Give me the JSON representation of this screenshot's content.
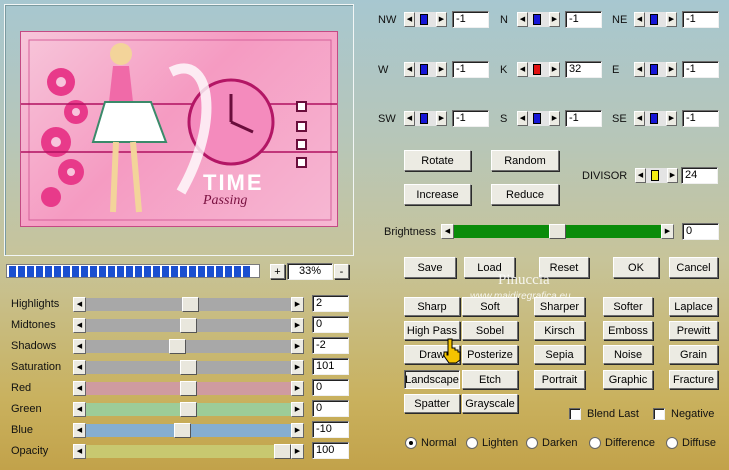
{
  "watermark": {
    "line1": "Pinuccia",
    "line2": "www.maidiregrafica.eu"
  },
  "preview": {
    "image_title": "TIME",
    "image_subtitle": "Passing",
    "zoom": "33%",
    "zoom_plus": "+",
    "zoom_minus": "-"
  },
  "directions": [
    {
      "label": "NW",
      "value": "-1",
      "color": "blue"
    },
    {
      "label": "N",
      "value": "-1",
      "color": "blue"
    },
    {
      "label": "NE",
      "value": "-1",
      "color": "blue"
    },
    {
      "label": "W",
      "value": "-1",
      "color": "blue"
    },
    {
      "label": "K",
      "value": "32",
      "color": "red"
    },
    {
      "label": "E",
      "value": "-1",
      "color": "blue"
    },
    {
      "label": "SW",
      "value": "-1",
      "color": "blue"
    },
    {
      "label": "S",
      "value": "-1",
      "color": "blue"
    },
    {
      "label": "SE",
      "value": "-1",
      "color": "blue"
    }
  ],
  "ops": {
    "rotate": "Rotate",
    "random": "Random",
    "increase": "Increase",
    "reduce": "Reduce"
  },
  "divisor": {
    "label": "DIVISOR",
    "value": "24"
  },
  "brightness": {
    "label": "Brightness",
    "value": "0",
    "level": 0.5,
    "color": "#0a8c0a"
  },
  "actions": {
    "save": "Save",
    "load": "Load",
    "reset": "Reset",
    "ok": "OK",
    "cancel": "Cancel"
  },
  "filters": [
    [
      "Sharp",
      "Soft",
      "Sharper",
      "Softer",
      "Laplace"
    ],
    [
      "High Pass",
      "Sobel",
      "Kirsch",
      "Emboss",
      "Prewitt"
    ],
    [
      "Draw",
      "Posterize",
      "Sepia",
      "Noise",
      "Grain"
    ],
    [
      "Landscape",
      "Etch",
      "Portrait",
      "Graphic",
      "Fracture"
    ],
    [
      "Spatter",
      "Grayscale"
    ]
  ],
  "options": {
    "blend_last": "Blend Last",
    "negative": "Negative"
  },
  "modes": {
    "selected": "Normal",
    "items": [
      "Normal",
      "Lighten",
      "Darken",
      "Difference",
      "Diffuse"
    ]
  },
  "adjustments": [
    {
      "label": "Highlights",
      "value": "2",
      "level": 0.51,
      "color": "#a8a8a8"
    },
    {
      "label": "Midtones",
      "value": "0",
      "level": 0.5,
      "color": "#a8a8a8"
    },
    {
      "label": "Shadows",
      "value": "-2",
      "level": 0.44,
      "color": "#a8a8a8"
    },
    {
      "label": "Saturation",
      "value": "101",
      "level": 0.5,
      "color": "#a8a8a8"
    },
    {
      "label": "Red",
      "value": "0",
      "level": 0.5,
      "color": "#cf9ba0"
    },
    {
      "label": "Green",
      "value": "0",
      "level": 0.5,
      "color": "#9dcc98"
    },
    {
      "label": "Blue",
      "value": "-10",
      "level": 0.47,
      "color": "#86aed0"
    },
    {
      "label": "Opacity",
      "value": "100",
      "level": 1.0,
      "color": "#c8c870"
    }
  ]
}
